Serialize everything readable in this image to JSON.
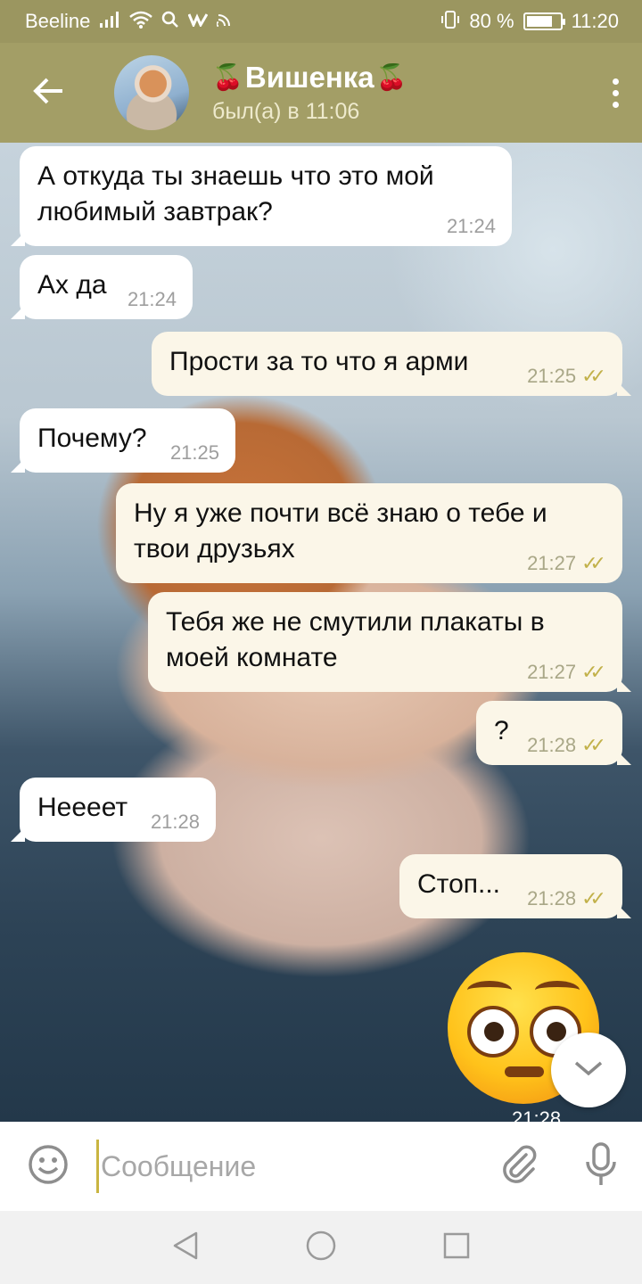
{
  "status": {
    "carrier": "Beeline",
    "battery": "80 %",
    "battery_level": 0.8,
    "clock": "11:20"
  },
  "header": {
    "title": "Вишенка",
    "subtitle": "был(а) в 11:06"
  },
  "messages": [
    {
      "dir": "in",
      "text": "А откуда ты знаешь что это мой любимый завтрак?",
      "time": "21:24"
    },
    {
      "dir": "in",
      "text": "Ах да",
      "time": "21:24"
    },
    {
      "dir": "out",
      "text": "Прости за то что я арми",
      "time": "21:25"
    },
    {
      "dir": "in",
      "text": "Почему?",
      "time": "21:25"
    },
    {
      "dir": "out",
      "text": "Ну я уже почти всё знаю о тебе и твои друзьях",
      "time": "21:27"
    },
    {
      "dir": "out",
      "text": "Тебя же не смутили плакаты в моей комнате",
      "time": "21:27"
    },
    {
      "dir": "out",
      "text": "?",
      "time": "21:28"
    },
    {
      "dir": "in",
      "text": "Нееeет",
      "time": "21:28"
    },
    {
      "dir": "out",
      "text": "Стоп...",
      "time": "21:28"
    },
    {
      "dir": "out",
      "sticker": "flushed-face-emoji",
      "time": "21:28"
    }
  ],
  "input": {
    "placeholder": "Сообщение"
  },
  "icons": {
    "back": "arrow-left-icon",
    "menu": "more-vertical-icon",
    "emoji": "smiley-icon",
    "attach": "paperclip-icon",
    "mic": "microphone-icon",
    "scroll": "chevron-down-icon"
  },
  "colors": {
    "header": "#a39e66",
    "outgoing_bubble": "#fbf6e8",
    "incoming_bubble": "#ffffff",
    "read_check": "#c2b14a"
  }
}
